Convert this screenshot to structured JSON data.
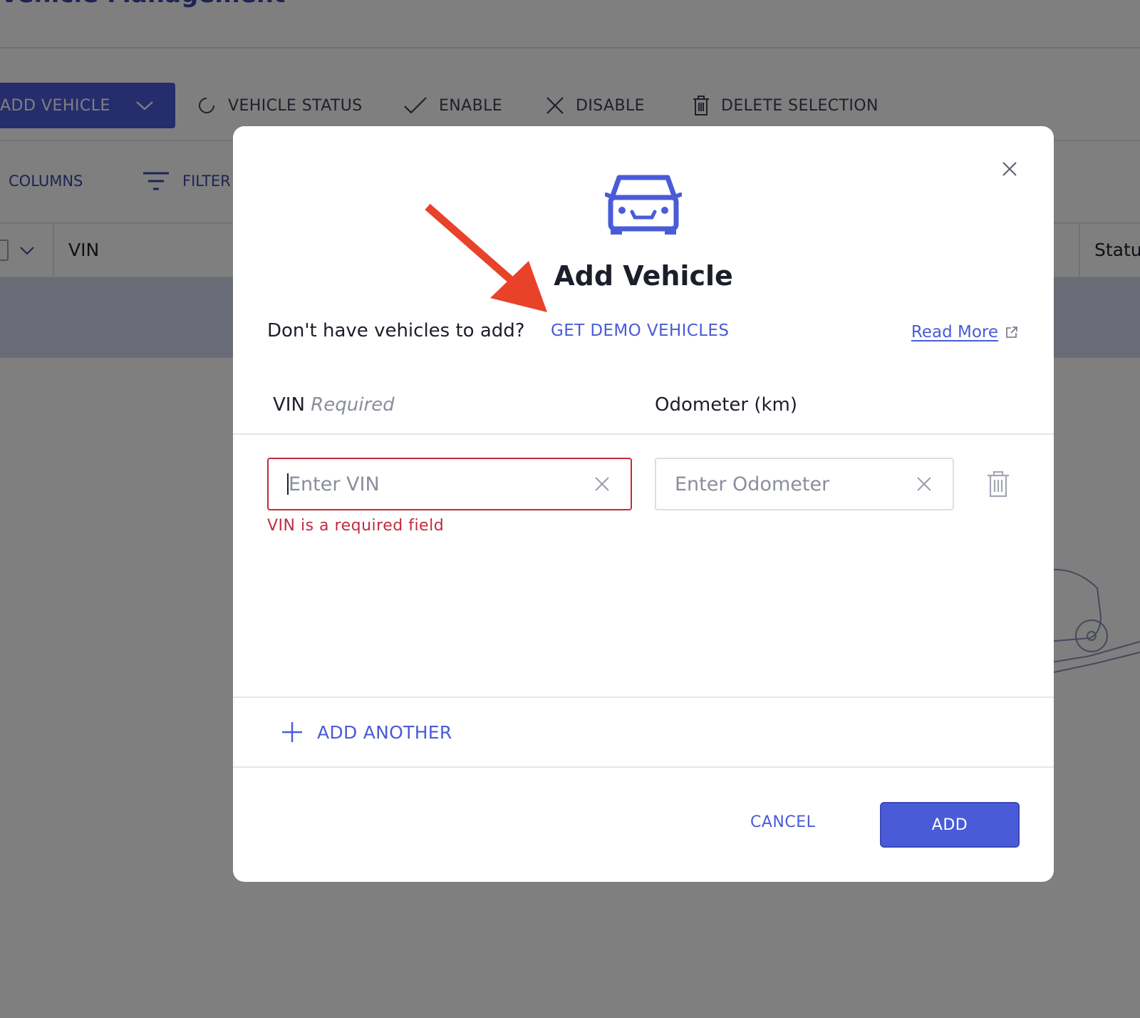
{
  "background": {
    "page_title": "Vehicle Management",
    "toolbar": {
      "add_vehicle_label": "ADD VEHICLE",
      "vehicle_status_label": "VEHICLE STATUS",
      "enable_label": "ENABLE",
      "disable_label": "DISABLE",
      "delete_selection_label": "DELETE SELECTION"
    },
    "subtoolbar": {
      "columns_label": "COLUMNS",
      "filter_label": "FILTER"
    },
    "table": {
      "headers": [
        "VIN",
        "Status"
      ]
    }
  },
  "modal": {
    "icon": "car-icon",
    "title": "Add Vehicle",
    "helper_question": "Don't have vehicles to add?",
    "demo_link_label": "GET DEMO VEHICLES",
    "read_more_label": "Read More",
    "columns": {
      "vin_label": "VIN",
      "vin_required": "Required",
      "odometer_label": "Odometer (km)"
    },
    "row": {
      "vin_placeholder": "Enter VIN",
      "vin_value": "",
      "odometer_placeholder": "Enter Odometer",
      "odometer_value": "",
      "vin_error": "VIN is a required field"
    },
    "add_another_label": "ADD ANOTHER",
    "cancel_label": "CANCEL",
    "add_label": "ADD"
  },
  "colors": {
    "accent": "#4a5bd8",
    "error": "#c22a3f",
    "annotation_arrow": "#e8432a"
  }
}
